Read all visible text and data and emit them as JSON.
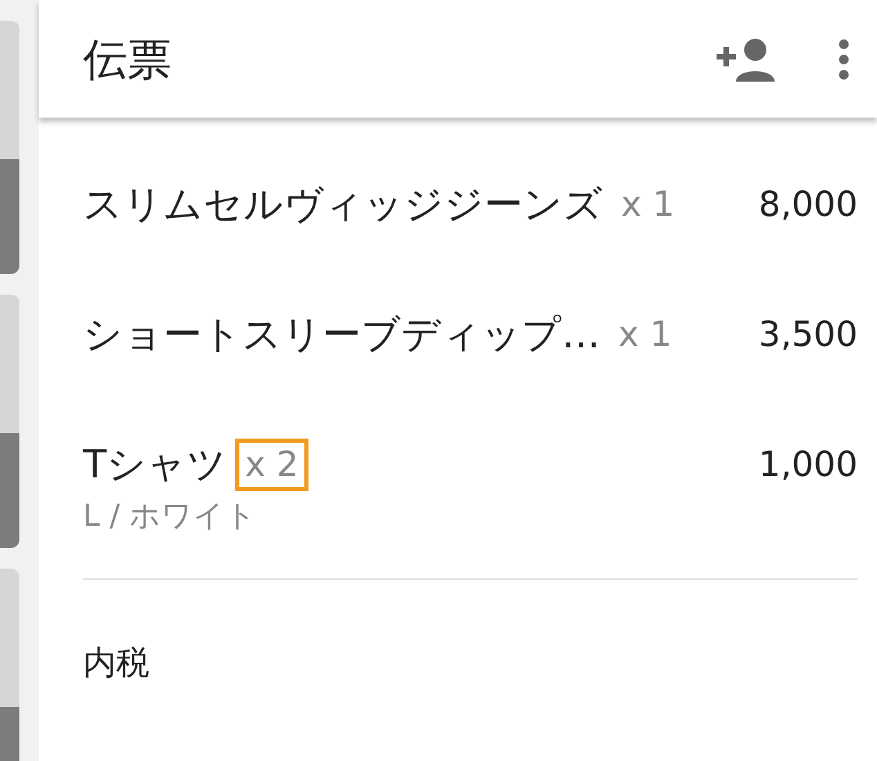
{
  "header": {
    "title": "伝票",
    "actions": [
      {
        "kind": "add-person"
      },
      {
        "kind": "more"
      }
    ]
  },
  "items": [
    {
      "name": "スリムセルヴィッジジーンズ",
      "quantity": "x 1",
      "price": "8,000",
      "highlighted": false
    },
    {
      "name": "ショートスリーブディップ…",
      "quantity": "x 1",
      "price": "3,500",
      "highlighted": false
    },
    {
      "name": "Tシャツ",
      "quantity": "x 2",
      "price": "1,000",
      "variant": "L / ホワイト",
      "highlighted": true
    }
  ],
  "tax_label": "内税"
}
